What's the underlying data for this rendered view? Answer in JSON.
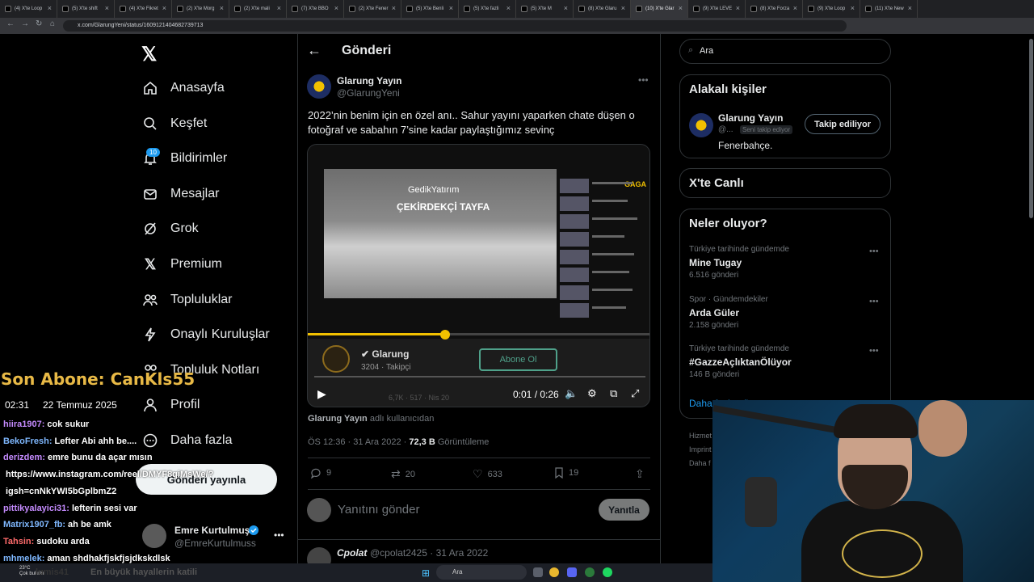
{
  "browser": {
    "tabs": [
      {
        "label": "(4) X'te Loop",
        "active": false
      },
      {
        "label": "(5) X'te shift",
        "active": false
      },
      {
        "label": "(4) X'te Fikret",
        "active": false
      },
      {
        "label": "(2) X'te Morg",
        "active": false
      },
      {
        "label": "(2) X'te mali",
        "active": false
      },
      {
        "label": "(7) X'te BBO",
        "active": false
      },
      {
        "label": "(2) X'te Fener",
        "active": false
      },
      {
        "label": "(5) X'te Benli",
        "active": false
      },
      {
        "label": "(5) X'te fazli",
        "active": false
      },
      {
        "label": "(5) X'te M",
        "active": false
      },
      {
        "label": "(8) X'te Glaru",
        "active": false
      },
      {
        "label": "(10) X'te Glar",
        "active": true
      },
      {
        "label": "(9) X'te LEVE",
        "active": false
      },
      {
        "label": "(8) X'te Forza",
        "active": false
      },
      {
        "label": "(9) X'te Loop",
        "active": false
      },
      {
        "label": "(11) X'te New",
        "active": false
      }
    ],
    "url": "x.com/GlarungYeni/status/1609121404682739713"
  },
  "nav": {
    "items": [
      {
        "label": "Anasayfa",
        "icon": "home-icon"
      },
      {
        "label": "Keşfet",
        "icon": "search-icon"
      },
      {
        "label": "Bildirimler",
        "icon": "bell-icon"
      },
      {
        "label": "Mesajlar",
        "icon": "mail-icon"
      },
      {
        "label": "Grok",
        "icon": "grok-icon"
      },
      {
        "label": "Premium",
        "icon": "x-logo-icon"
      },
      {
        "label": "Topluluklar",
        "icon": "people-icon"
      },
      {
        "label": "Onaylı Kuruluşlar",
        "icon": "lightning-icon"
      },
      {
        "label": "Topluluk Notları",
        "icon": "notes-icon"
      },
      {
        "label": "Profil",
        "icon": "person-icon"
      },
      {
        "label": "Daha fazla",
        "icon": "more-circle-icon"
      }
    ],
    "notif_badge": "10",
    "post_button": "Gönderi yayınla",
    "user": {
      "name": "Emre Kurtulmuş",
      "handle": "@EmreKurtulmuss"
    }
  },
  "main": {
    "title": "Gönderi",
    "tweet": {
      "name": "Glarung Yayın",
      "handle": "@GlarungYeni",
      "text": "2022’nin benim için en özel anı.. Sahur yayını yaparken chate düşen o fotoğraf  ve sabahın 7’sine kadar paylaştığımız sevinç",
      "caption_name": "Glarung Yayın",
      "caption_rest": " adlı kullanıcıdan",
      "time": "ÖS 12:36 · 31 Ara 2022 · ",
      "views": "72,3 B",
      "views_label": " Görüntüleme",
      "replies": "9",
      "retweets": "20",
      "likes": "633",
      "bookmarks": "19"
    },
    "video": {
      "overlay_brand": "GedikYatırım",
      "overlay_title": "ÇEKİRDEKÇİ TAYFA",
      "overlay_logo": "GAGA",
      "channel": "Glarung",
      "subscribers": "3204 · Takipçi",
      "subscribe": "Abone Ol",
      "time": "0:01 / 0:26",
      "progress": 0.4,
      "stats": "6,7K   ·   517   ·   Nis 20"
    },
    "reply": {
      "placeholder": "Yanıtını gönder",
      "button": "Yanıtla"
    },
    "comment": {
      "name": "Cpolat",
      "handle": "@cpolat2425 · 31 Ara 2022"
    }
  },
  "right": {
    "search": "Ara",
    "related_title": "Alakalı kişiler",
    "related": {
      "name": "Glarung Yayın",
      "handle": "@...",
      "follows_you": "Seni takip ediyor",
      "bio": "Fenerbahçe.",
      "button": "Takip ediliyor"
    },
    "live_title": "X'te Canlı",
    "trends_title": "Neler oluyor?",
    "trends": [
      {
        "category": "Türkiye tarihinde gündemde",
        "name": "Mine Tugay",
        "count": "6.516 gönderi"
      },
      {
        "category": "Spor · Gündemdekiler",
        "name": "Arda Güler",
        "count": "2.158 gönderi"
      },
      {
        "category": "Türkiye tarihinde gündemde",
        "name": "#GazzeAçlıktanÖlüyor",
        "count": "146 B gönderi"
      }
    ],
    "show_more": "Daha fazla göster",
    "footer": [
      "Hizmet",
      "Imprint",
      "Daha f"
    ]
  },
  "stream": {
    "last_sub": "Son Abone: CanKls55",
    "clock": "02:31",
    "date": "22 Temmuz 2025",
    "chat": [
      {
        "user": "hiira1907:",
        "msg": "cok sukur",
        "color": "#c58bff"
      },
      {
        "user": "BekoFresh:",
        "msg": "Lefter Abi ahh be....",
        "color": "#7fb8ff"
      },
      {
        "user": "derizdem:",
        "msg": "emre bunu da açar mısın",
        "color": "#c58bff"
      },
      {
        "user": "",
        "msg": "https://www.instagram.com/reel/DMYF8qiMsWe/?",
        "color": "#fff"
      },
      {
        "user": "",
        "msg": "igsh=cnNkYWI5bGplbmZ2",
        "color": "#fff"
      },
      {
        "user": "pittikyalayici31:",
        "msg": "lefterin sesi var",
        "color": "#c58bff"
      },
      {
        "user": "Matrix1907_fb:",
        "msg": "ah be amk",
        "color": "#7fb8ff"
      },
      {
        "user": "Tahsin:",
        "msg": "sudoku arda",
        "color": "#ff6b6b"
      },
      {
        "user": "mhmelek:",
        "msg": "aman shdhakfjskfjsjdkskdlsk",
        "color": "#7fb8ff"
      }
    ],
    "ticker": "En büyük hayallerin katili",
    "ticker_user": "lumis41",
    "weather": "23°C\nÇok bulutlu"
  },
  "taskbar": {
    "search": "Ara"
  }
}
